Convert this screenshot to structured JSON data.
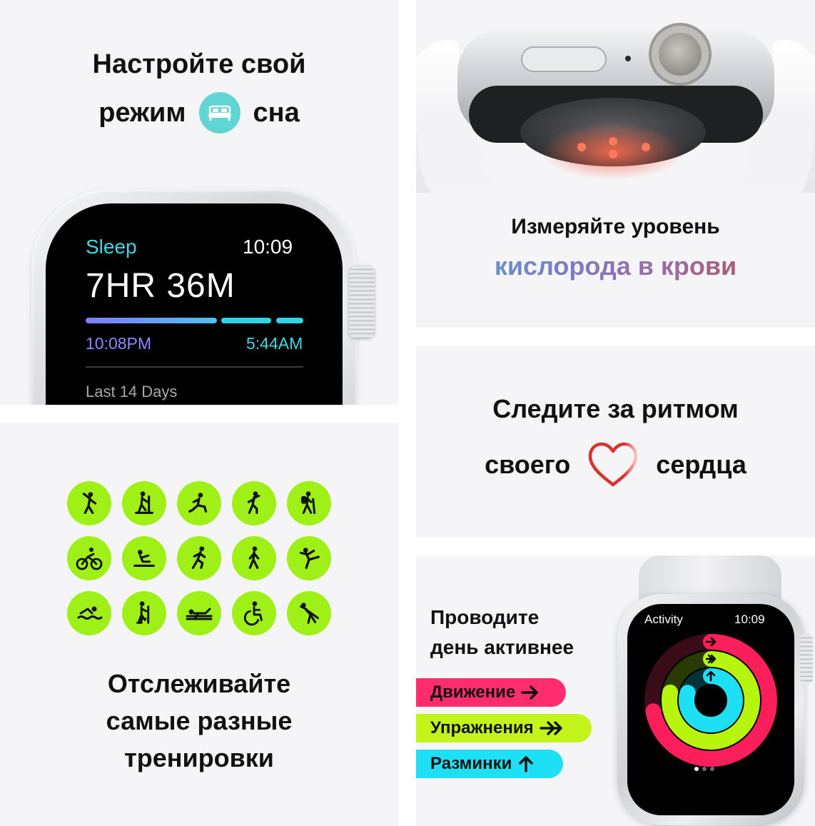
{
  "sleep_panel": {
    "headline_line1": "Настройте свой",
    "headline_word1": "режим",
    "headline_word2": "сна",
    "icon": "bed-icon",
    "watch": {
      "app_title": "Sleep",
      "clock": "10:09",
      "duration": "7HR 36M",
      "start_time": "10:08PM",
      "end_time": "5:44AM",
      "caption": "Last 14 Days"
    }
  },
  "workouts_panel": {
    "icons": [
      "dance-icon",
      "elliptical-icon",
      "stretching-icon",
      "hiit-icon",
      "hiking-icon",
      "cycling-icon",
      "rowing-icon",
      "running-icon",
      "walking-icon",
      "yoga-icon",
      "swimming-icon",
      "stair-stepper-icon",
      "pilates-icon",
      "wheelchair-icon",
      "cooldown-icon"
    ],
    "headline_line1": "Отслеживайте",
    "headline_line2": "самые разные",
    "headline_line3": "тренировки"
  },
  "oxygen_panel": {
    "headline_line1": "Измеряйте уровень",
    "headline_line2": "кислорода в крови"
  },
  "heart_panel": {
    "headline_line1": "Следите за ритмом",
    "headline_word1": "своего",
    "headline_word2": "сердца",
    "icon": "heart-icon"
  },
  "activity_panel": {
    "title_line1": "Проводите",
    "title_line2": "день активнее",
    "pills": [
      {
        "label": "Движение",
        "color": "#ff2d6f",
        "icon": "arrow-right-icon"
      },
      {
        "label": "Упражнения",
        "color": "#c4f51a",
        "icon": "double-arrow-right-icon"
      },
      {
        "label": "Разминки",
        "color": "#1ee0f5",
        "icon": "arrow-up-icon"
      }
    ],
    "watch": {
      "app_title": "Activity",
      "clock": "10:09",
      "move_ring": 0.72,
      "exercise_ring": 0.78,
      "stand_ring": 0.8
    }
  },
  "colors": {
    "background": "#f5f5f7",
    "sleep_accent": "#5fd5d4",
    "workout_green": "#9ef016",
    "heart_red": "#d9322d"
  }
}
